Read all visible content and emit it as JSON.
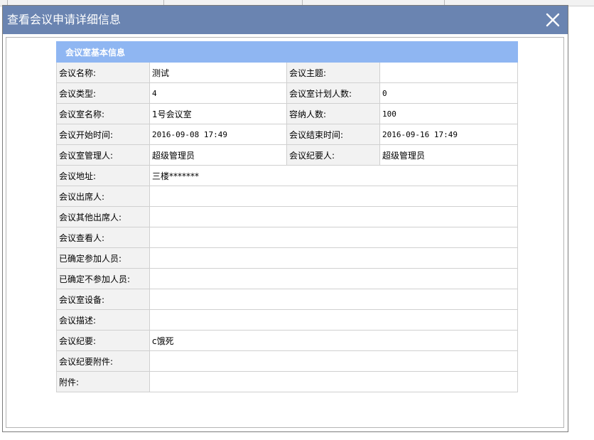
{
  "dialog": {
    "title": "查看会议申请详细信息"
  },
  "section": {
    "title": "会议室基本信息"
  },
  "rows": [
    {
      "type": "pair",
      "l1": "会议名称:",
      "v1": "测试",
      "l2": "会议主题:",
      "v2": ""
    },
    {
      "type": "pair",
      "l1": "会议类型:",
      "v1": "4",
      "l2": "会议室计划人数:",
      "v2": "0"
    },
    {
      "type": "pair",
      "l1": "会议室名称:",
      "v1": "1号会议室",
      "l2": "容纳人数:",
      "v2": "100"
    },
    {
      "type": "pair",
      "l1": "会议开始时间:",
      "v1": "2016-09-08 17:49",
      "l2": "会议结束时间:",
      "v2": "2016-09-16 17:49"
    },
    {
      "type": "pair",
      "l1": "会议室管理人:",
      "v1": "超级管理员",
      "l2": "会议纪要人:",
      "v2": "超级管理员"
    },
    {
      "type": "single",
      "l1": "会议地址:",
      "v1": "三楼*******"
    },
    {
      "type": "single",
      "l1": "会议出席人:",
      "v1": ""
    },
    {
      "type": "single",
      "l1": "会议其他出席人:",
      "v1": ""
    },
    {
      "type": "single",
      "l1": "会议查看人:",
      "v1": ""
    },
    {
      "type": "single",
      "l1": "已确定参加人员:",
      "v1": ""
    },
    {
      "type": "single",
      "l1": "已确定不参加人员:",
      "v1": ""
    },
    {
      "type": "single",
      "l1": "会议室设备:",
      "v1": ""
    },
    {
      "type": "single",
      "l1": "会议描述:",
      "v1": ""
    },
    {
      "type": "single",
      "l1": "会议纪要:",
      "v1": "c饿死"
    },
    {
      "type": "single",
      "l1": "会议纪要附件:",
      "v1": ""
    },
    {
      "type": "single",
      "l1": "附件:",
      "v1": ""
    }
  ],
  "colors": {
    "header_bg": "#6a84b1",
    "section_bg": "#8fb6f2",
    "label_bg": "#f2f2f2"
  },
  "icons": {
    "close": "close-icon"
  }
}
